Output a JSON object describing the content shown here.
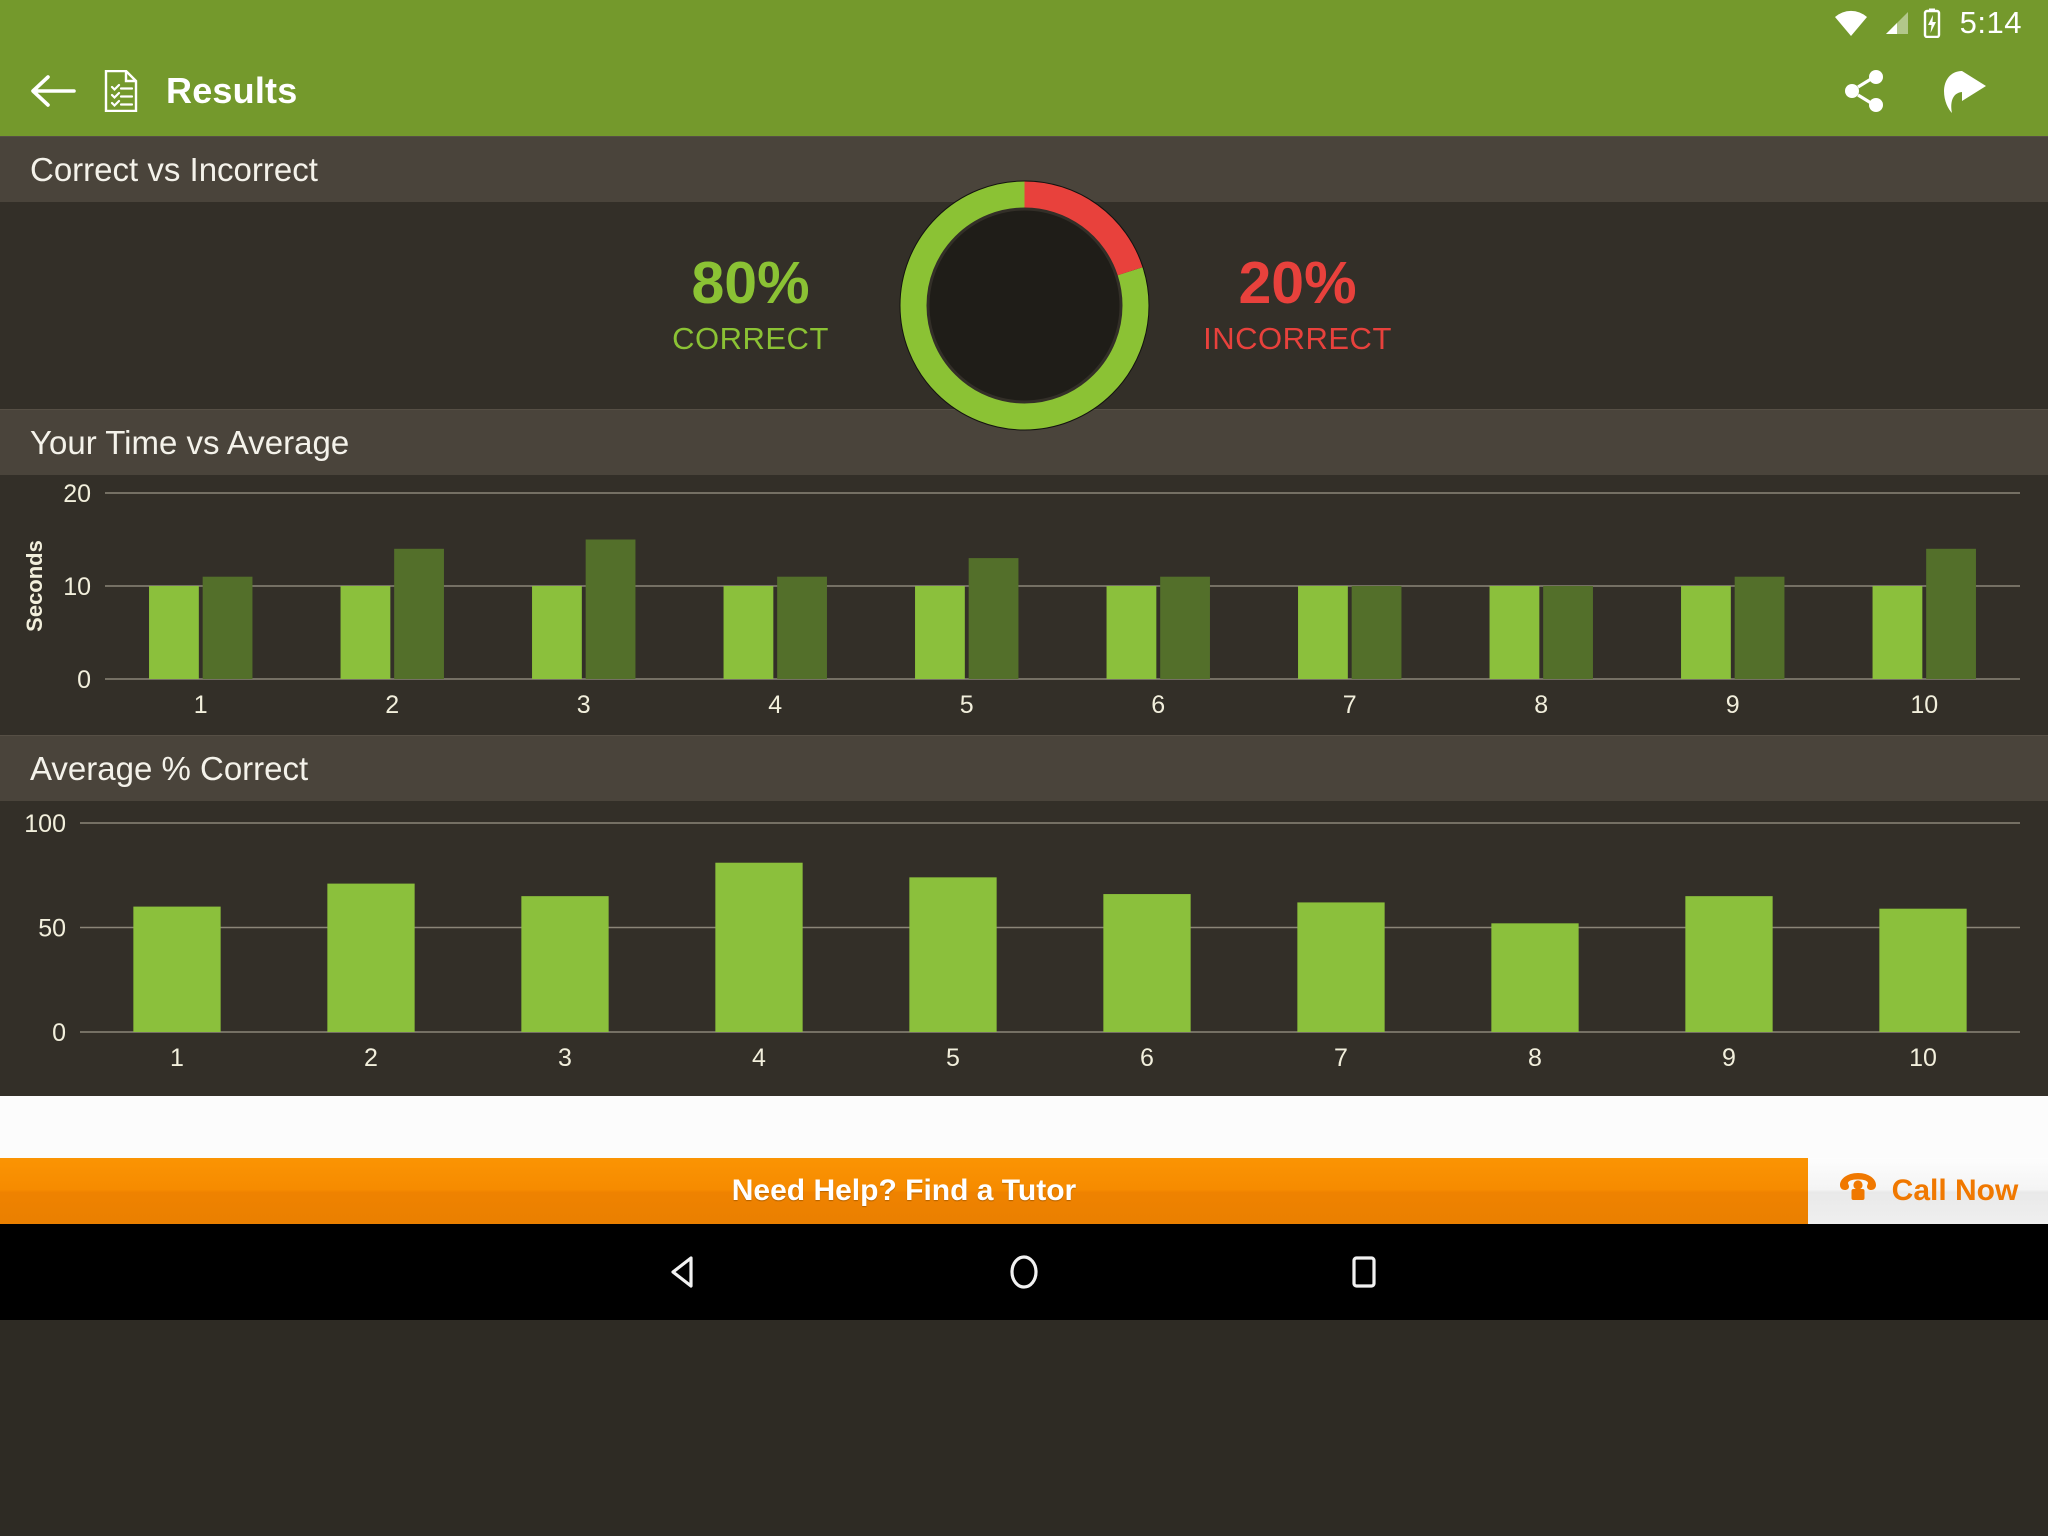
{
  "status_bar": {
    "time": "5:14",
    "icons": [
      "wifi-icon",
      "cellular-signal-icon",
      "battery-charging-icon"
    ]
  },
  "app_bar": {
    "back_icon": "back-arrow-icon",
    "doc_icon": "results-document-icon",
    "title": "Results",
    "share_icon": "share-icon",
    "next_icon": "next-arrow-icon"
  },
  "sections": {
    "correct_vs_incorrect": {
      "header": "Correct vs Incorrect",
      "correct_pct": "80%",
      "correct_label": "CORRECT",
      "incorrect_pct": "20%",
      "incorrect_label": "INCORRECT",
      "correct_color": "#8bc234",
      "incorrect_color": "#e8413c",
      "ring_bg_color": "#1f1d18"
    },
    "time_vs_average": {
      "header": "Your Time vs Average"
    },
    "average_correct": {
      "header": "Average % Correct"
    }
  },
  "chart_data": [
    {
      "type": "bar",
      "title": "Your Time vs Average",
      "xlabel": "",
      "ylabel": "Seconds",
      "categories": [
        "1",
        "2",
        "3",
        "4",
        "5",
        "6",
        "7",
        "8",
        "9",
        "10"
      ],
      "ylim": [
        0,
        20
      ],
      "yticks": [
        0,
        10,
        20
      ],
      "grid": true,
      "legend": "none",
      "series": [
        {
          "name": "Your Time",
          "color": "#8bc03c",
          "values": [
            10,
            10,
            10,
            10,
            10,
            10,
            10,
            10,
            10,
            10
          ]
        },
        {
          "name": "Average",
          "color": "#536f2a",
          "values": [
            11,
            14,
            15,
            11,
            13,
            11,
            10,
            10,
            11,
            14
          ]
        }
      ]
    },
    {
      "type": "bar",
      "title": "Average % Correct",
      "xlabel": "",
      "ylabel": "",
      "categories": [
        "1",
        "2",
        "3",
        "4",
        "5",
        "6",
        "7",
        "8",
        "9",
        "10"
      ],
      "ylim": [
        0,
        100
      ],
      "yticks": [
        0,
        50,
        100
      ],
      "grid": true,
      "legend": "none",
      "series": [
        {
          "name": "Average % Correct",
          "color": "#8bc03c",
          "values": [
            60,
            71,
            65,
            81,
            74,
            66,
            62,
            52,
            65,
            59
          ]
        }
      ]
    }
  ],
  "tutor_banner": {
    "message": "Need Help? Find a Tutor",
    "call_label": "Call Now",
    "phone_icon": "phone-icon",
    "banner_color": "#f68b00"
  },
  "nav_bar": {
    "back": "nav-back-icon",
    "home": "nav-home-icon",
    "recents": "nav-recents-icon"
  }
}
